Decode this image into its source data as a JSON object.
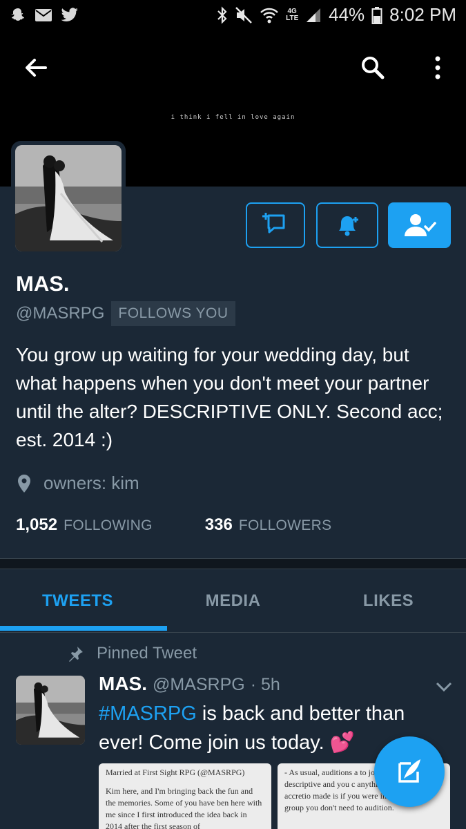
{
  "status_bar": {
    "battery": "44%",
    "time": "8:02 PM",
    "network": "4G LTE"
  },
  "header": {
    "banner_caption": "i think i fell in love again"
  },
  "profile": {
    "display_name": "MAS.",
    "handle": "@MASRPG",
    "follows_you": "FOLLOWS YOU",
    "bio": "You grow up waiting for your wedding day, but what happens when you don't meet your partner until the alter? DESCRIPTIVE ONLY. Second acc; est. 2014 :)",
    "location": "owners: kim",
    "following_count": "1,052",
    "following_label": "FOLLOWING",
    "followers_count": "336",
    "followers_label": "FOLLOWERS"
  },
  "tabs": [
    {
      "label": "TWEETS",
      "active": true
    },
    {
      "label": "MEDIA",
      "active": false
    },
    {
      "label": "LIKES",
      "active": false
    }
  ],
  "pinned_tweet": {
    "pinned_label": "Pinned Tweet",
    "name": "MAS.",
    "handle": "@MASRPG",
    "time": "· 5h",
    "hashtag": "#MASRPG",
    "text_rest": " is back and better than ever! Come join us today. 💕",
    "card1_title": "Married at First Sight RPG (@MASRPG)",
    "card1_body": "Kim here, and I'm bringing back the fun and the memories. Some of you have ben here with me since I first introduced the idea back in 2014 after the first season of",
    "card2_body": "- As usual, auditions a to join the group. Th descriptive and you c anything. The only accretio made is if you were in the original group you don't need to audition."
  },
  "colors": {
    "background": "#1b2836",
    "accent": "#1da1f2",
    "muted": "#8899a6"
  }
}
